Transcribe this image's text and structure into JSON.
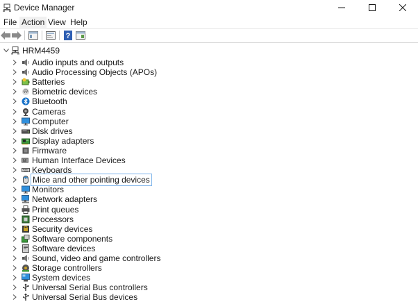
{
  "window": {
    "title": "Device Manager",
    "app_icon": "device-manager-icon"
  },
  "menu": {
    "items": [
      "File",
      "Action",
      "View",
      "Help"
    ],
    "active": "Action"
  },
  "toolbar": {
    "buttons": [
      "back-icon",
      "forward-icon",
      "properties-icon",
      "update-driver-icon",
      "help-icon",
      "view-icon"
    ]
  },
  "tree": {
    "root": {
      "label": "HRM4459",
      "icon": "computer-root-icon",
      "expanded": true
    },
    "categories": [
      {
        "label": "Audio inputs and outputs",
        "icon": "speaker-icon"
      },
      {
        "label": "Audio Processing Objects (APOs)",
        "icon": "speaker-icon"
      },
      {
        "label": "Batteries",
        "icon": "battery-icon"
      },
      {
        "label": "Biometric devices",
        "icon": "fingerprint-icon"
      },
      {
        "label": "Bluetooth",
        "icon": "bluetooth-icon"
      },
      {
        "label": "Cameras",
        "icon": "camera-icon"
      },
      {
        "label": "Computer",
        "icon": "monitor-icon"
      },
      {
        "label": "Disk drives",
        "icon": "disk-icon"
      },
      {
        "label": "Display adapters",
        "icon": "display-adapter-icon"
      },
      {
        "label": "Firmware",
        "icon": "firmware-icon"
      },
      {
        "label": "Human Interface Devices",
        "icon": "hid-icon"
      },
      {
        "label": "Keyboards",
        "icon": "keyboard-icon"
      },
      {
        "label": "Mice and other pointing devices",
        "icon": "mouse-icon",
        "selected": true
      },
      {
        "label": "Monitors",
        "icon": "monitor-icon"
      },
      {
        "label": "Network adapters",
        "icon": "network-icon"
      },
      {
        "label": "Print queues",
        "icon": "printer-icon"
      },
      {
        "label": "Processors",
        "icon": "processor-icon"
      },
      {
        "label": "Security devices",
        "icon": "security-icon"
      },
      {
        "label": "Software components",
        "icon": "software-component-icon"
      },
      {
        "label": "Software devices",
        "icon": "software-device-icon"
      },
      {
        "label": "Sound, video and game controllers",
        "icon": "speaker-icon"
      },
      {
        "label": "Storage controllers",
        "icon": "storage-icon"
      },
      {
        "label": "System devices",
        "icon": "system-icon"
      },
      {
        "label": "Universal Serial Bus controllers",
        "icon": "usb-icon"
      },
      {
        "label": "Universal Serial Bus devices",
        "icon": "usb-icon"
      }
    ]
  },
  "colors": {
    "selection_border": "#7eb4ea",
    "accent_blue": "#1a73c9"
  }
}
